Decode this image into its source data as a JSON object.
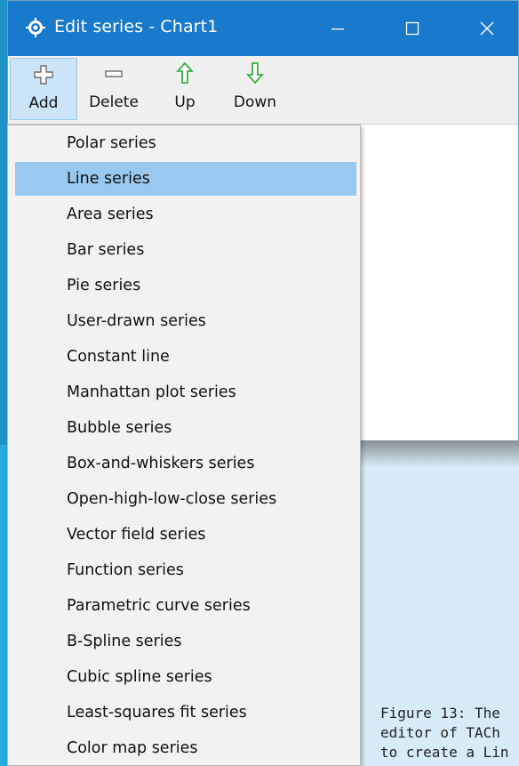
{
  "window": {
    "title": "Edit series - Chart1",
    "app_icon": "tachart-editor-icon",
    "controls": {
      "minimize": "minimize-icon",
      "maximize": "maximize-icon",
      "close": "close-icon"
    }
  },
  "toolbar": {
    "add_label": "Add",
    "delete_label": "Delete",
    "up_label": "Up",
    "down_label": "Down"
  },
  "menu": {
    "selected_index": 1,
    "items": [
      {
        "label": "Polar series"
      },
      {
        "label": "Line series"
      },
      {
        "label": "Area series"
      },
      {
        "label": "Bar series"
      },
      {
        "label": "Pie series"
      },
      {
        "label": "User-drawn series"
      },
      {
        "label": "Constant line"
      },
      {
        "label": "Manhattan plot series"
      },
      {
        "label": "Bubble series"
      },
      {
        "label": "Box-and-whiskers series"
      },
      {
        "label": "Open-high-low-close series"
      },
      {
        "label": "Vector field series"
      },
      {
        "label": "Function series"
      },
      {
        "label": "Parametric curve series"
      },
      {
        "label": "B-Spline series"
      },
      {
        "label": "Cubic spline series"
      },
      {
        "label": "Least-squares fit series"
      },
      {
        "label": "Color map series"
      }
    ]
  },
  "caption": {
    "line1": "Figure 13: The",
    "line2": "editor of TACh",
    "line3": "to create a Lin"
  },
  "colors": {
    "title_bar": "#1979ca",
    "selected_item": "#99c9ef",
    "add_button_bg": "#cce4f7",
    "up_arrow": "#3cb043",
    "down_arrow": "#3cb043",
    "background": "#d7ecf7"
  }
}
